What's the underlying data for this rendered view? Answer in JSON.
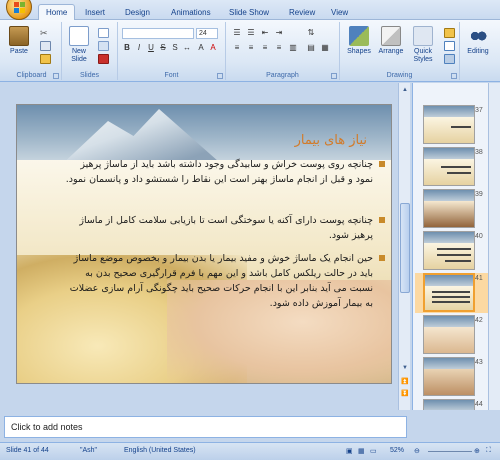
{
  "ribbon": {
    "tabs": [
      "Home",
      "Insert",
      "Design",
      "Animations",
      "Slide Show",
      "Review",
      "View"
    ],
    "active_tab": "Home",
    "groups": {
      "clipboard": {
        "label": "Clipboard",
        "paste": "Paste"
      },
      "slides": {
        "label": "Slides",
        "new_slide": "New Slide"
      },
      "font": {
        "label": "Font",
        "font_name": "",
        "font_size": "24"
      },
      "paragraph": {
        "label": "Paragraph"
      },
      "drawing": {
        "label": "Drawing",
        "shapes": "Shapes",
        "arrange": "Arrange",
        "quick_styles": "Quick Styles"
      },
      "editing": {
        "label": "Editing",
        "find": "Editing"
      }
    }
  },
  "slide": {
    "title": "نیاز های بیمار",
    "bullets": [
      "چنانچه روی پوست خراش و سابیدگی وجود داشته باشد باید از ماساژ پرهیز نمود و قبل از انجام ماساژ بهتر است این نقاط را شستشو داد و پانسمان نمود.",
      "چنانچه پوست دارای آکنه یا سوختگی است تا بازیابی سلامت کامل از ماساژ پرهیز شود.",
      "حین انجام یک ماساژ خوش و مفید بیمار یا بدن بیمار و بخصوص موضع ماساژ باید در حالت ریلکس کامل باشد و این مهم با فرم قرارگیری صحیح بدن به نسبت می آید بنابر این با انجام حرکات صحیح باید چگونگی آرام سازی عضلات به بیمار آموزش داده شود."
    ],
    "accent_color": "#d27b2a"
  },
  "notes": {
    "placeholder": "Click to add notes"
  },
  "thumbnails": {
    "items": [
      {
        "num": "37"
      },
      {
        "num": "38"
      },
      {
        "num": "39"
      },
      {
        "num": "40"
      },
      {
        "num": "41",
        "selected": true
      },
      {
        "num": "42"
      },
      {
        "num": "43"
      },
      {
        "num": "44"
      }
    ]
  },
  "status": {
    "slide_info": "Slide 41 of 44",
    "theme": "\"Ash\"",
    "language": "English (United States)",
    "zoom": "52%"
  }
}
